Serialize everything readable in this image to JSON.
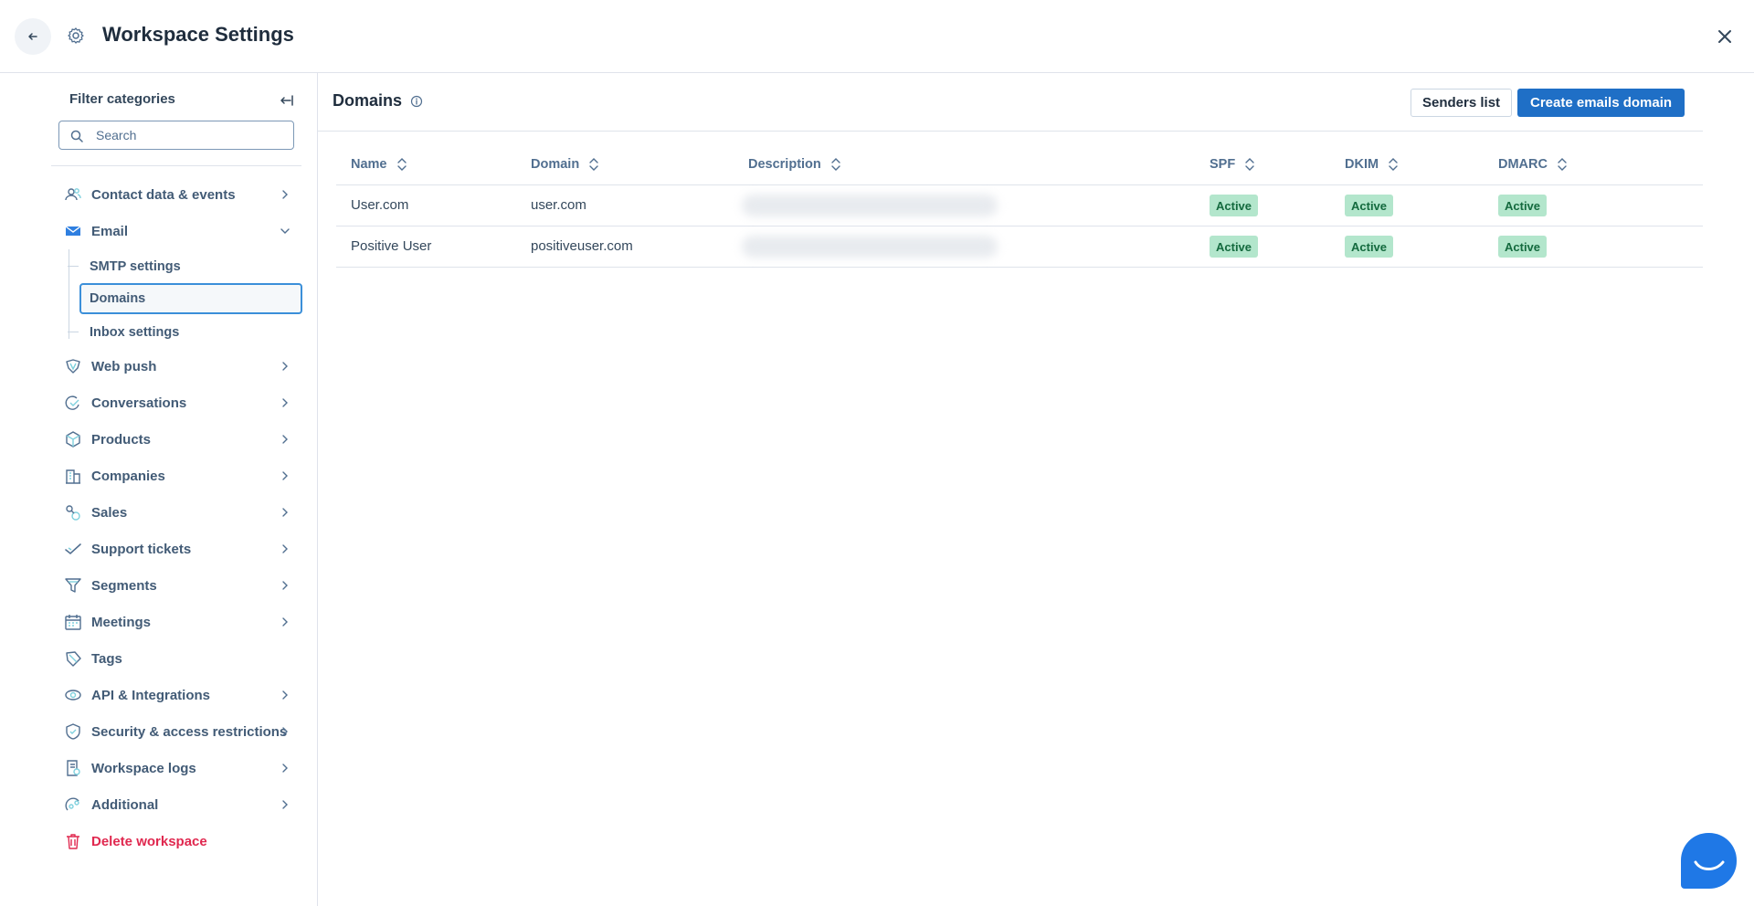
{
  "header": {
    "title": "Workspace Settings"
  },
  "sidebar": {
    "filter_title": "Filter categories",
    "search_placeholder": "Search",
    "items": [
      {
        "label": "Contact data & events",
        "icon": "contacts-icon",
        "chevron": true
      },
      {
        "label": "Email",
        "icon": "mail-icon",
        "expanded": true,
        "children": [
          {
            "label": "SMTP settings"
          },
          {
            "label": "Domains",
            "active": true
          },
          {
            "label": "Inbox settings"
          }
        ]
      },
      {
        "label": "Web push",
        "icon": "web-push-icon",
        "chevron": true
      },
      {
        "label": "Conversations",
        "icon": "conversations-icon",
        "chevron": true
      },
      {
        "label": "Products",
        "icon": "box-icon",
        "chevron": true
      },
      {
        "label": "Companies",
        "icon": "building-icon",
        "chevron": true
      },
      {
        "label": "Sales",
        "icon": "sales-icon",
        "chevron": true
      },
      {
        "label": "Support tickets",
        "icon": "ticket-icon",
        "chevron": true
      },
      {
        "label": "Segments",
        "icon": "funnel-icon",
        "chevron": true
      },
      {
        "label": "Meetings",
        "icon": "calendar-icon",
        "chevron": true
      },
      {
        "label": "Tags",
        "icon": "tag-icon",
        "chevron": false
      },
      {
        "label": "API & Integrations",
        "icon": "api-icon",
        "chevron": true
      },
      {
        "label": "Security & access restrictions",
        "icon": "shield-icon",
        "chevron": true
      },
      {
        "label": "Workspace logs",
        "icon": "logs-icon",
        "chevron": true
      },
      {
        "label": "Additional",
        "icon": "additional-icon",
        "chevron": true
      },
      {
        "label": "Delete workspace",
        "icon": "trash-icon",
        "chevron": false,
        "danger": true
      }
    ]
  },
  "main": {
    "title": "Domains",
    "senders_button": "Senders list",
    "create_button": "Create emails domain",
    "columns": [
      "Name",
      "Domain",
      "Description",
      "SPF",
      "DKIM",
      "DMARC"
    ],
    "rows": [
      {
        "name": "User.com",
        "domain": "user.com",
        "spf": "Active",
        "dkim": "Active",
        "dmarc": "Active"
      },
      {
        "name": "Positive User",
        "domain": "positiveuser.com",
        "spf": "Active",
        "dkim": "Active",
        "dmarc": "Active"
      }
    ]
  },
  "colors": {
    "primary": "#1f6fc6",
    "badge_bg": "#b3e6cc",
    "badge_text": "#146a3e",
    "danger": "#e0284f"
  }
}
